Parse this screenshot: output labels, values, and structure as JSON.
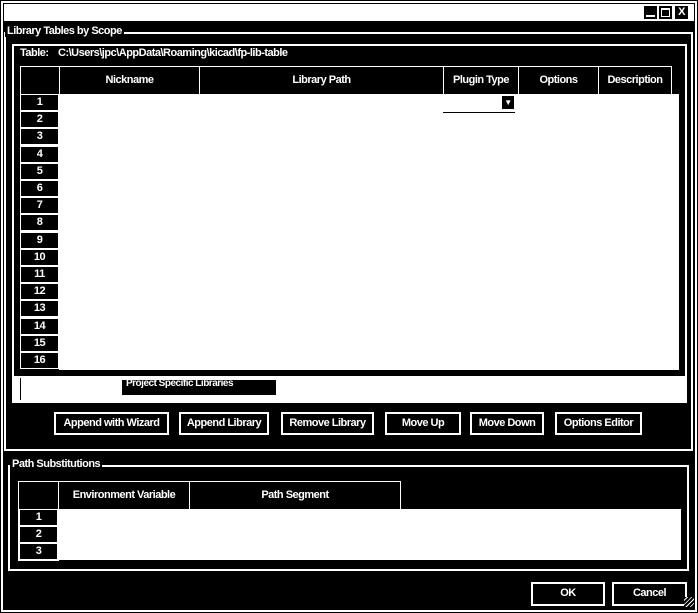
{
  "window": {
    "buttons": [
      "minimize",
      "maximize",
      "close"
    ],
    "close_label": "X"
  },
  "library_group": {
    "title": "Library Tables by Scope",
    "table_label": "Table:",
    "table_path": "C:\\Users\\jpc\\AppData\\Roaming\\kicad\\fp-lib-table",
    "columns": [
      "Nickname",
      "Library Path",
      "Plugin Type",
      "Options",
      "Description"
    ],
    "rows": [
      "1",
      "2",
      "3",
      "4",
      "5",
      "6",
      "7",
      "8",
      "9",
      "10",
      "11",
      "12",
      "13",
      "14",
      "15",
      "16"
    ],
    "tabs": [
      "",
      "Project Specific Libraries"
    ],
    "buttons": [
      "Append with Wizard",
      "Append Library",
      "Remove Library",
      "Move Up",
      "Move Down",
      "Options Editor"
    ]
  },
  "path_group": {
    "title": "Path Substitutions",
    "columns": [
      "Environment Variable",
      "Path Segment"
    ],
    "rows": [
      "1",
      "2",
      "3"
    ]
  },
  "dialog_buttons": {
    "ok": "OK",
    "cancel": "Cancel"
  }
}
